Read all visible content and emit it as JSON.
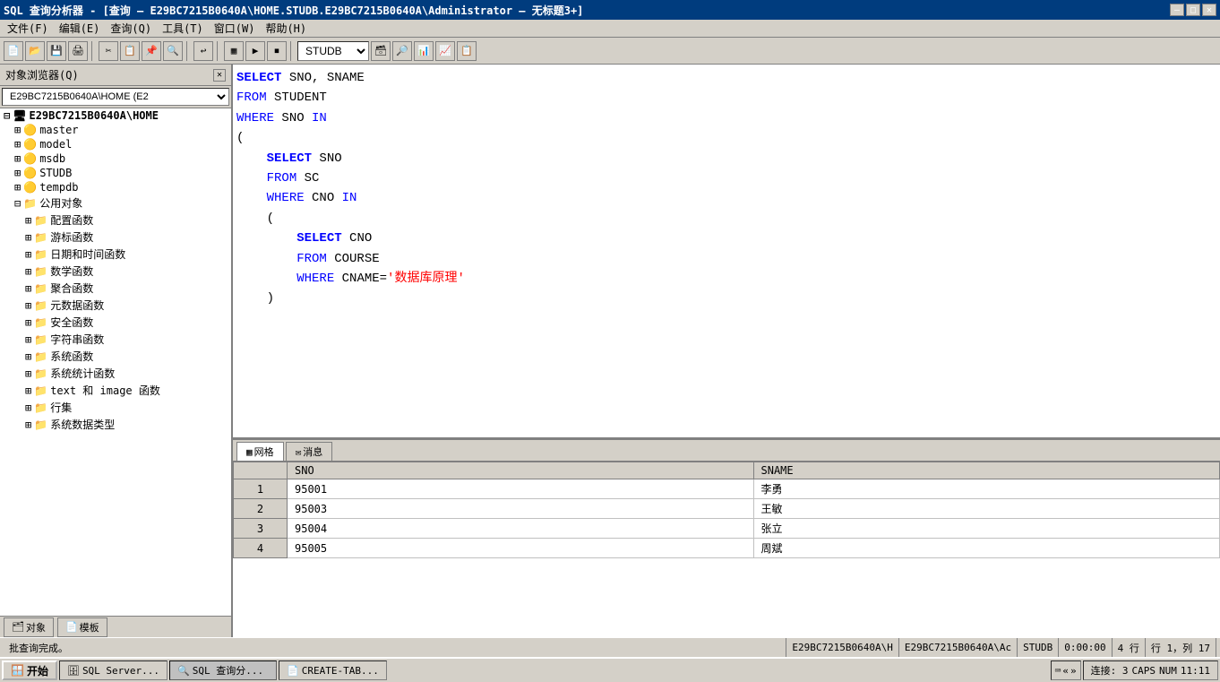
{
  "titleBar": {
    "text": "SQL 查询分析器 - [查询 — E29BC7215B0640A\\HOME.STUDB.E29BC7215B0640A\\Administrator — 无标题3+]",
    "minBtn": "—",
    "maxBtn": "□",
    "closeBtn": "✕"
  },
  "menuBar": {
    "items": [
      {
        "label": "文件(F)"
      },
      {
        "label": "编辑(E)"
      },
      {
        "label": "查询(Q)"
      },
      {
        "label": "工具(T)"
      },
      {
        "label": "窗口(W)"
      },
      {
        "label": "帮助(H)"
      }
    ]
  },
  "toolbar": {
    "database": "STUDB"
  },
  "sidebar": {
    "title": "对象浏览器(Q)",
    "dropdownValue": "E29BC7215B0640A\\HOME (E2",
    "treeItems": [
      {
        "level": "root",
        "label": "E29BC7215B0640A\\HOME",
        "icon": "server",
        "expanded": true
      },
      {
        "level": "level1",
        "label": "master",
        "icon": "db",
        "expanded": false
      },
      {
        "level": "level1",
        "label": "model",
        "icon": "db",
        "expanded": false
      },
      {
        "level": "level1",
        "label": "msdb",
        "icon": "db",
        "expanded": false
      },
      {
        "level": "level1",
        "label": "STUDB",
        "icon": "db",
        "expanded": false
      },
      {
        "level": "level1",
        "label": "tempdb",
        "icon": "db",
        "expanded": false
      },
      {
        "level": "level1",
        "label": "公用对象",
        "icon": "folder",
        "expanded": true
      },
      {
        "level": "level2",
        "label": "配置函数",
        "icon": "folder",
        "expanded": false
      },
      {
        "level": "level2",
        "label": "游标函数",
        "icon": "folder",
        "expanded": false
      },
      {
        "level": "level2",
        "label": "日期和时间函数",
        "icon": "folder",
        "expanded": false
      },
      {
        "level": "level2",
        "label": "数学函数",
        "icon": "folder",
        "expanded": false
      },
      {
        "level": "level2",
        "label": "聚合函数",
        "icon": "folder",
        "expanded": false
      },
      {
        "level": "level2",
        "label": "元数据函数",
        "icon": "folder",
        "expanded": false
      },
      {
        "level": "level2",
        "label": "安全函数",
        "icon": "folder",
        "expanded": false
      },
      {
        "level": "level2",
        "label": "字符串函数",
        "icon": "folder",
        "expanded": false
      },
      {
        "level": "level2",
        "label": "系统函数",
        "icon": "folder",
        "expanded": false
      },
      {
        "level": "level2",
        "label": "系统统计函数",
        "icon": "folder",
        "expanded": false
      },
      {
        "level": "level2",
        "label": "text 和 image 函数",
        "icon": "folder",
        "expanded": false
      },
      {
        "level": "level2",
        "label": "行集",
        "icon": "folder",
        "expanded": false
      },
      {
        "level": "level2",
        "label": "系统数据类型",
        "icon": "folder",
        "expanded": false
      }
    ],
    "bottomTabs": [
      {
        "label": "对象",
        "icon": "🗂",
        "active": false
      },
      {
        "label": "模板",
        "icon": "📄",
        "active": false
      }
    ]
  },
  "queryEditor": {
    "lines": [
      {
        "tokens": [
          {
            "type": "kw",
            "text": "SELECT"
          },
          {
            "type": "normal",
            "text": " SNO, SNAME"
          }
        ]
      },
      {
        "tokens": [
          {
            "type": "kw2",
            "text": "FROM"
          },
          {
            "type": "normal",
            "text": " STUDENT"
          }
        ]
      },
      {
        "tokens": [
          {
            "type": "kw2",
            "text": "WHERE"
          },
          {
            "type": "normal",
            "text": " SNO "
          },
          {
            "type": "kw2",
            "text": "IN"
          }
        ]
      },
      {
        "tokens": [
          {
            "type": "normal",
            "text": "("
          }
        ]
      },
      {
        "tokens": [
          {
            "type": "kw",
            "text": "    SELECT"
          },
          {
            "type": "normal",
            "text": " SNO"
          }
        ]
      },
      {
        "tokens": [
          {
            "type": "kw2",
            "text": "    FROM"
          },
          {
            "type": "normal",
            "text": " SC"
          }
        ]
      },
      {
        "tokens": [
          {
            "type": "kw2",
            "text": "    WHERE"
          },
          {
            "type": "normal",
            "text": " CNO "
          },
          {
            "type": "kw2",
            "text": "IN"
          }
        ]
      },
      {
        "tokens": [
          {
            "type": "normal",
            "text": "    ("
          }
        ]
      },
      {
        "tokens": [
          {
            "type": "kw",
            "text": "        SELECT"
          },
          {
            "type": "normal",
            "text": " CNO"
          }
        ]
      },
      {
        "tokens": [
          {
            "type": "kw2",
            "text": "        FROM"
          },
          {
            "type": "normal",
            "text": " COURSE"
          }
        ]
      },
      {
        "tokens": [
          {
            "type": "kw2",
            "text": "        WHERE"
          },
          {
            "type": "normal",
            "text": " CNAME="
          },
          {
            "type": "str",
            "text": "'数据库原理'"
          }
        ]
      },
      {
        "tokens": [
          {
            "type": "normal",
            "text": "    )"
          }
        ]
      }
    ]
  },
  "resultsTabs": [
    {
      "label": "网格",
      "icon": "▦",
      "active": true
    },
    {
      "label": "消息",
      "icon": "✉",
      "active": false
    }
  ],
  "resultsTable": {
    "columns": [
      "SNO",
      "SNAME"
    ],
    "rows": [
      {
        "rowNum": "1",
        "sno": "95001",
        "sname": "李勇"
      },
      {
        "rowNum": "2",
        "sno": "95003",
        "sname": "王敏"
      },
      {
        "rowNum": "3",
        "sno": "95004",
        "sname": "张立"
      },
      {
        "rowNum": "4",
        "sno": "95005",
        "sname": "周斌"
      }
    ]
  },
  "statusBar": {
    "message": "批查询完成。",
    "connection": "E29BC7215B0640A\\H",
    "user": "E29BC7215B0640A\\Ac",
    "database": "STUDB",
    "time": "0:00:00",
    "rowInfo": "4 行",
    "rowCol": "行 1，列 17"
  },
  "taskbar": {
    "startLabel": "开始",
    "items": [
      {
        "label": "SQL Server...",
        "icon": "🗄",
        "active": false
      },
      {
        "label": "SQL 查询分...",
        "icon": "🔍",
        "active": true
      },
      {
        "label": "CREATE-TAB...",
        "icon": "📄",
        "active": false
      }
    ],
    "tray": "« »",
    "clock": "11:11",
    "connection": "连接: 3",
    "capsLock": "CAPS",
    "numLock": "NUM"
  }
}
